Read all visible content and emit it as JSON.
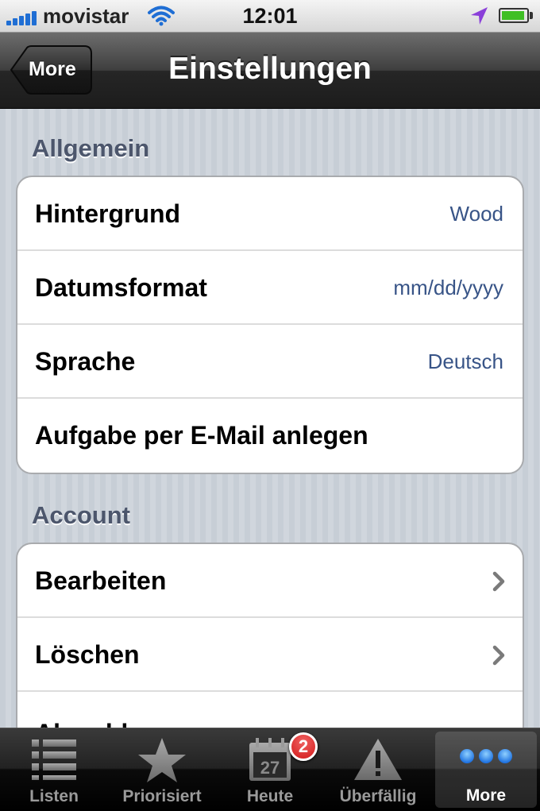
{
  "status_bar": {
    "carrier": "movistar",
    "time": "12:01",
    "signal_bars": 5,
    "battery_level": 0.9,
    "icons": [
      "signal-icon",
      "wifi-icon",
      "location-arrow-icon",
      "battery-icon"
    ]
  },
  "nav": {
    "title": "Einstellungen",
    "back_label": "More"
  },
  "sections": {
    "general": {
      "header": "Allgemein",
      "rows": [
        {
          "label": "Hintergrund",
          "value": "Wood"
        },
        {
          "label": "Datumsformat",
          "value": "mm/dd/yyyy"
        },
        {
          "label": "Sprache",
          "value": "Deutsch"
        },
        {
          "label": "Aufgabe per E-Mail anlegen",
          "value": ""
        }
      ]
    },
    "account": {
      "header": "Account",
      "rows": [
        {
          "label": "Bearbeiten",
          "accessory": "chevron-right-icon"
        },
        {
          "label": "Löschen",
          "accessory": "chevron-right-icon"
        },
        {
          "label": "Abmelden"
        }
      ]
    }
  },
  "tabbar": {
    "tabs": [
      {
        "label": "Listen",
        "icon": "list-icon"
      },
      {
        "label": "Priorisiert",
        "icon": "star-icon"
      },
      {
        "label": "Heute",
        "icon": "calendar-icon",
        "calendar_day": "27"
      },
      {
        "label": "Überfällig",
        "icon": "warning-icon"
      },
      {
        "label": "More",
        "icon": "more-dots-icon"
      }
    ],
    "active_tab": "More",
    "today_badge": "2"
  },
  "colors": {
    "accent_value": "#385487",
    "section_header": "#4c566c",
    "badge_red": "#d21818",
    "tab_more_dots": "#3c8cff"
  }
}
